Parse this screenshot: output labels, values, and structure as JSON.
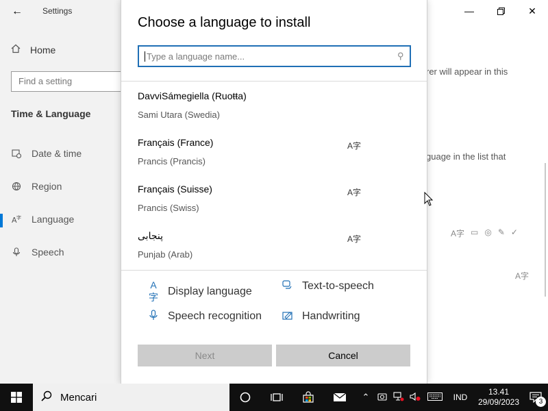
{
  "settings": {
    "app_title": "Settings",
    "home_label": "Home",
    "find_placeholder": "Find a setting",
    "section_title": "Time & Language",
    "nav": [
      {
        "label": "Date & time",
        "icon": "calendar-clock-icon"
      },
      {
        "label": "Region",
        "icon": "globe-icon"
      },
      {
        "label": "Language",
        "icon": "language-icon"
      },
      {
        "label": "Speech",
        "icon": "microphone-icon"
      }
    ],
    "active_nav": "Language",
    "bg_text_1": "rer will appear in this",
    "bg_text_2": "guage in the list that",
    "window_controls": {
      "minimize": "minimize-icon",
      "maximize": "restore-icon",
      "close": "close-icon"
    }
  },
  "dialog": {
    "title": "Choose a language to install",
    "search_placeholder": "Type a language name...",
    "languages": [
      {
        "name": "DavviSámegiella (Ruoŧŧa)",
        "native": "Sami Utara (Swedia)",
        "display_language": false
      },
      {
        "name": "Français (France)",
        "native": "Prancis (Prancis)",
        "display_language": true
      },
      {
        "name": "Français (Suisse)",
        "native": "Prancis (Swiss)",
        "display_language": true
      },
      {
        "name": "پنجابی",
        "native": "Punjab (Arab)",
        "display_language": true
      }
    ],
    "features": {
      "display_language": "Display language",
      "text_to_speech": "Text-to-speech",
      "speech_recognition": "Speech recognition",
      "handwriting": "Handwriting"
    },
    "next_label": "Next",
    "cancel_label": "Cancel"
  },
  "taskbar": {
    "search_label": "Mencari",
    "language": "IND",
    "time": "13.41",
    "date": "29/09/2023",
    "notification_count": "3"
  }
}
